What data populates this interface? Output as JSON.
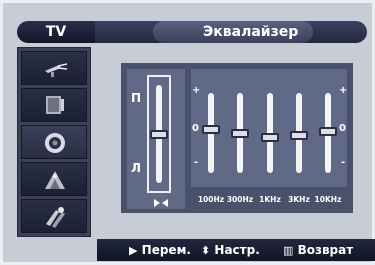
{
  "header": {
    "tv_label": "TV",
    "title": "Эквалайзер"
  },
  "sidebar": {
    "items": [
      {
        "name": "picture",
        "icon": "antenna-icon",
        "active": false
      },
      {
        "name": "sound",
        "icon": "tv-icon",
        "active": false
      },
      {
        "name": "speaker",
        "icon": "speaker-icon",
        "active": true
      },
      {
        "name": "channel",
        "icon": "satellite-dish-icon",
        "active": false
      },
      {
        "name": "setup",
        "icon": "tools-icon",
        "active": false
      }
    ]
  },
  "balance": {
    "left_label": "П",
    "right_label": "Л",
    "level": 0.5,
    "icon": "mute-icon"
  },
  "equalizer": {
    "plus_label": "+",
    "zero_label": "0",
    "minus_label": "-",
    "bands": [
      {
        "freq": "100Hz",
        "level": 0.55
      },
      {
        "freq": "300Hz",
        "level": 0.5
      },
      {
        "freq": "1KHz",
        "level": 0.45
      },
      {
        "freq": "3KHz",
        "level": 0.48
      },
      {
        "freq": "10KHz",
        "level": 0.52
      }
    ]
  },
  "help": {
    "move_icon": "arrow-right-icon",
    "move_label": "Перем.",
    "adjust_icon": "up-down-arrow-icon",
    "adjust_label": "Настр.",
    "return_icon": "return-icon",
    "return_label": "Возврат"
  }
}
